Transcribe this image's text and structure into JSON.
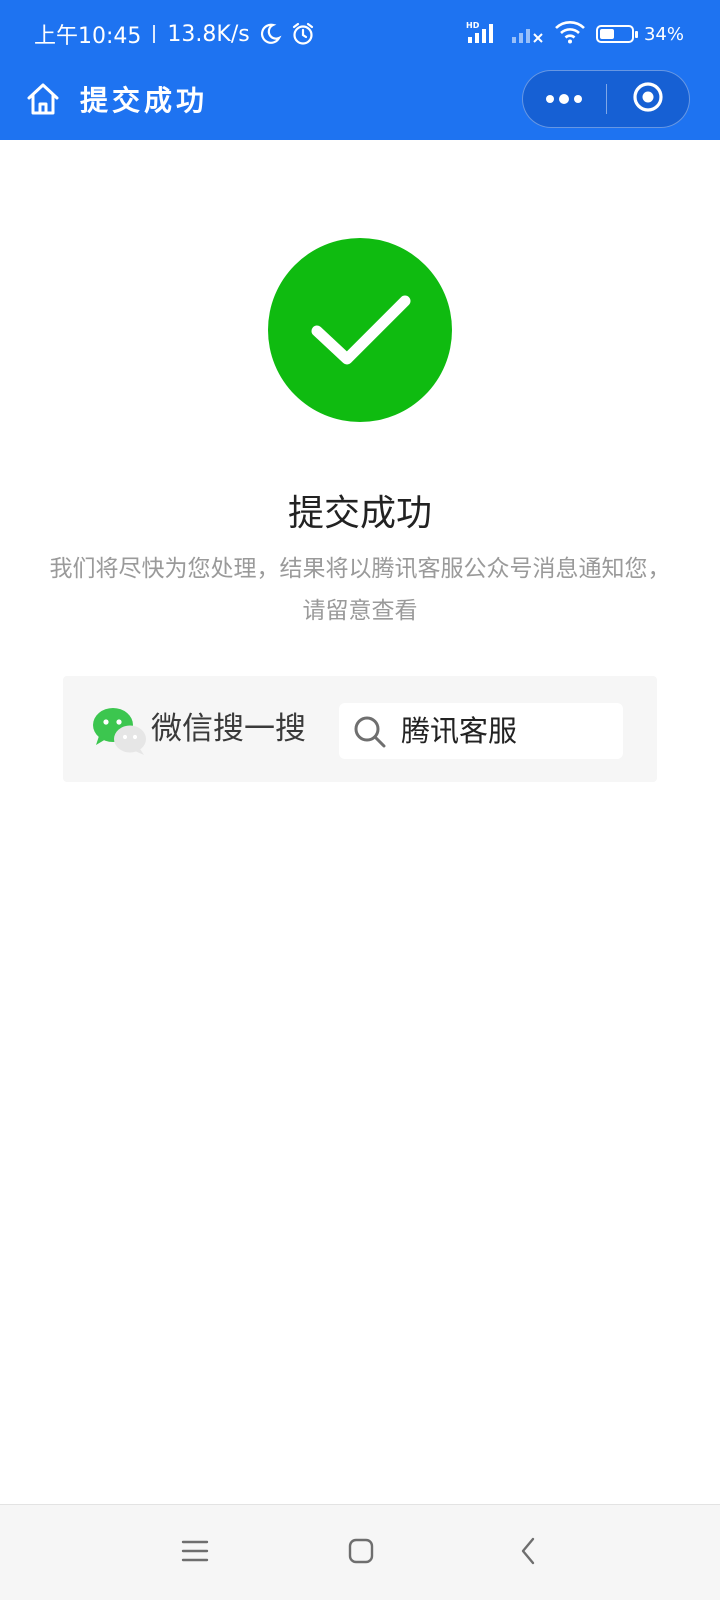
{
  "status_bar": {
    "time": "上午10:45",
    "net_speed": "13.8K/s",
    "battery_text": "34%",
    "battery_level": 0.34,
    "icons": [
      "moon-icon",
      "alarm-icon",
      "hd-signal-icon",
      "no-signal-icon",
      "wifi-icon",
      "battery-icon"
    ]
  },
  "nav": {
    "title": "提交成功",
    "icons": [
      "home-icon",
      "more-icon",
      "close-target-icon"
    ]
  },
  "result": {
    "icon": "check-icon",
    "title": "提交成功",
    "description": "我们将尽快为您处理，结果将以腾讯客服公众号消息通知您，请留意查看"
  },
  "search_card": {
    "logo": "wechat-logo",
    "label": "微信搜一搜",
    "value": "腾讯客服",
    "icon": "search-icon"
  },
  "system_nav": {
    "icons": [
      "menu-icon",
      "home-square-icon",
      "back-icon"
    ]
  },
  "colors": {
    "brand_blue": "#1e73f1",
    "success_green": "#0fbb10",
    "muted_text": "#9a9a9a"
  }
}
